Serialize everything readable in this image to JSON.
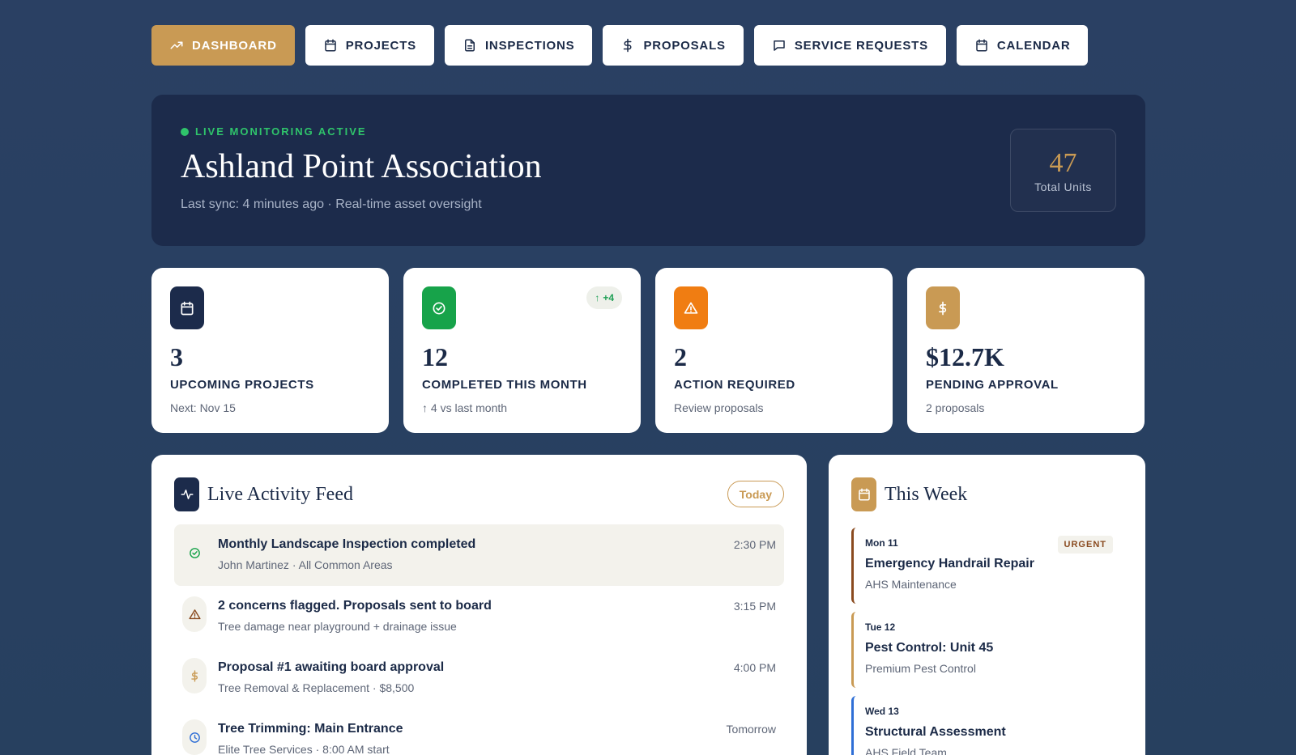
{
  "nav": [
    {
      "label": "DASHBOARD",
      "icon": "trending-up-icon",
      "active": true
    },
    {
      "label": "PROJECTS",
      "icon": "calendar-icon"
    },
    {
      "label": "INSPECTIONS",
      "icon": "document-icon"
    },
    {
      "label": "PROPOSALS",
      "icon": "dollar-icon"
    },
    {
      "label": "SERVICE REQUESTS",
      "icon": "message-icon"
    },
    {
      "label": "CALENDAR",
      "icon": "calendar-icon"
    }
  ],
  "hero": {
    "status": "LIVE MONITORING ACTIVE",
    "title": "Ashland Point Association",
    "subtitle": "Last sync: 4 minutes ago · Real-time asset oversight",
    "units_value": "47",
    "units_label": "Total Units"
  },
  "stats": [
    {
      "value": "3",
      "label": "UPCOMING PROJECTS",
      "sub": "Next: Nov 15",
      "icon": "calendar-icon",
      "color": "#1c2b4b"
    },
    {
      "value": "12",
      "label": "COMPLETED THIS MONTH",
      "sub": "↑ 4 vs last month",
      "icon": "check-circle-icon",
      "color": "#17a34a",
      "badge": "+4"
    },
    {
      "value": "2",
      "label": "ACTION REQUIRED",
      "sub": "Review proposals",
      "icon": "warning-icon",
      "color": "#f07d12"
    },
    {
      "value": "$12.7K",
      "label": "PENDING APPROVAL",
      "sub": "2 proposals",
      "icon": "dollar-icon",
      "color": "#c99a54"
    }
  ],
  "feed": {
    "title": "Live Activity Feed",
    "filter": "Today",
    "items": [
      {
        "title": "Monthly Landscape Inspection completed",
        "sub": "John Martinez · All Common Areas",
        "time": "2:30 PM",
        "icon": "check-circle-icon",
        "color": "#17a34a"
      },
      {
        "title": "2 concerns flagged. Proposals sent to board",
        "sub": "Tree damage near playground + drainage issue",
        "time": "3:15 PM",
        "icon": "warning-icon",
        "color": "#8a4a1f"
      },
      {
        "title": "Proposal #1 awaiting board approval",
        "sub": "Tree Removal & Replacement · $8,500",
        "time": "4:00 PM",
        "icon": "dollar-icon",
        "color": "#c99a54"
      },
      {
        "title": "Tree Trimming: Main Entrance",
        "sub": "Elite Tree Services · 8:00 AM start",
        "time": "Tomorrow",
        "icon": "clock-icon",
        "color": "#2f6fd6"
      }
    ]
  },
  "week": {
    "title": "This Week",
    "events": [
      {
        "day": "Mon 11",
        "title": "Emergency Handrail Repair",
        "sub": "AHS Maintenance",
        "badge": "URGENT",
        "color": "#8a4a1f"
      },
      {
        "day": "Tue 12",
        "title": "Pest Control: Unit 45",
        "sub": "Premium Pest Control",
        "color": "#c99a54"
      },
      {
        "day": "Wed 13",
        "title": "Structural Assessment",
        "sub": "AHS Field Team",
        "color": "#2f6fd6"
      }
    ]
  }
}
